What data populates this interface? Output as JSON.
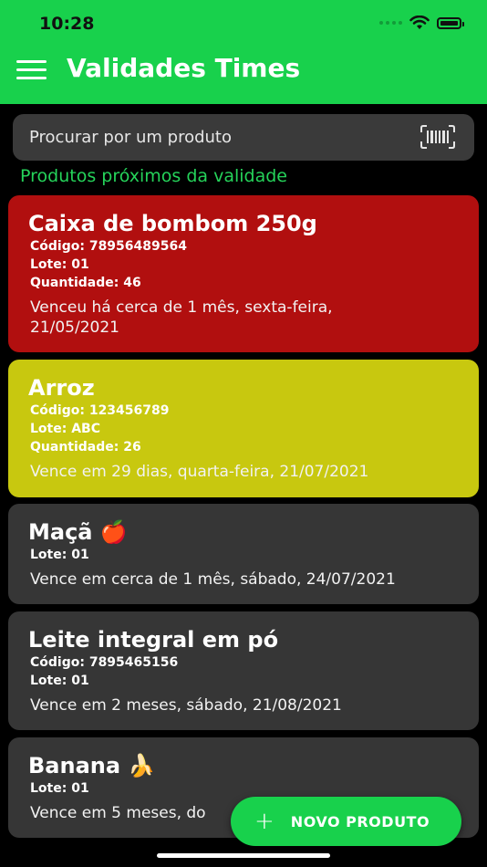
{
  "status_bar": {
    "time": "10:28"
  },
  "header": {
    "title": "Validades Times"
  },
  "search": {
    "placeholder": "Procurar por um produto"
  },
  "section": {
    "title": "Produtos próximos da validade"
  },
  "products": [
    {
      "name": "Caixa de bombom 250g",
      "codigo": "Código: 7895648956​4",
      "lote": "Lote: 01",
      "quantidade": "Quantidade: 46",
      "status": "Venceu há cerca de 1 mês, sexta-feira, 21/05/2021",
      "color": "#b10f0f"
    },
    {
      "name": "Arroz",
      "codigo": "Código: 123456789",
      "lote": "Lote: ABC",
      "quantidade": "Quantidade: 26",
      "status": "Vence em 29 dias, quarta-feira, 21/07/2021",
      "color": "#c8c80f"
    },
    {
      "name": "Maçã 🍎",
      "lote": "Lote: 01",
      "status": "Vence em cerca de 1 mês, sábado, 24/07/2021",
      "color": "#363636"
    },
    {
      "name": "Leite integral em pó",
      "codigo": "Código: 7895465156",
      "lote": "Lote: 01",
      "status": "Vence em 2 meses, sábado, 21/08/2021",
      "color": "#363636"
    },
    {
      "name": "Banana 🍌",
      "lote": "Lote: 01",
      "status": "Vence em 5 meses, do",
      "color": "#363636"
    }
  ],
  "fab": {
    "plus": "+",
    "label": "NOVO PRODUTO"
  },
  "colors": {
    "accent": "#18d14c",
    "expired": "#b10f0f",
    "warning": "#c8c80f",
    "card": "#363636"
  }
}
